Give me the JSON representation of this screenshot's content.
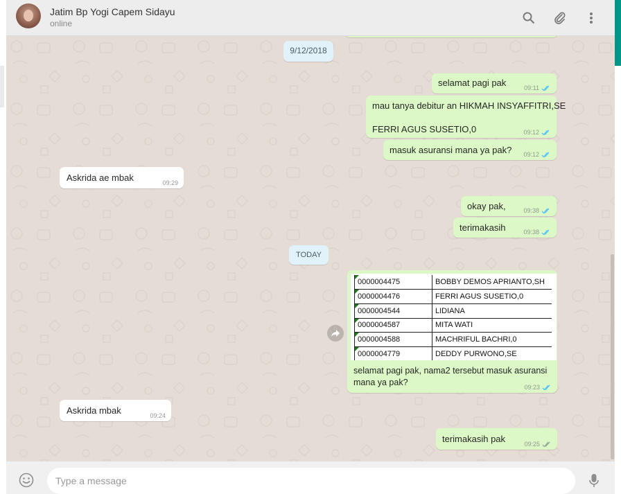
{
  "header": {
    "contact_name": "Jatim Bp Yogi Capem Sidayu",
    "status": "online",
    "icons": [
      "search-icon",
      "attach-icon",
      "menu-icon"
    ]
  },
  "dates": {
    "first": "9/12/2018",
    "today": "TODAY"
  },
  "messages": [
    {
      "dir": "out",
      "text": "selamat pagi pak",
      "time": "09:11"
    },
    {
      "dir": "out",
      "lines": [
        "mau tanya debitur an HIKMAH INSYAFFITRI,SE",
        "FERRI AGUS SUSETIO,0"
      ],
      "time": "09:12"
    },
    {
      "dir": "out",
      "text": "masuk asuransi mana ya pak?",
      "time": "09:12"
    },
    {
      "dir": "in",
      "text": "Askrida ae mbak",
      "time": "09:29"
    },
    {
      "dir": "out",
      "text": "okay pak,",
      "time": "09:38"
    },
    {
      "dir": "out",
      "text": "terimakasih",
      "time": "09:38"
    },
    {
      "dir": "out",
      "caption": [
        "selamat pagi pak, nama2 tersebut masuk asuransi",
        "mana ya pak?"
      ],
      "time": "09:23",
      "table": [
        [
          "0000004475",
          "BOBBY DEMOS APRIANTO,SH"
        ],
        [
          "0000004476",
          "FERRI AGUS SUSETIO,0"
        ],
        [
          "0000004544",
          "LIDIANA"
        ],
        [
          "0000004587",
          "MITA WATI"
        ],
        [
          "0000004588",
          "MACHRIFUL BACHRI,0"
        ],
        [
          "0000004779",
          "DEDDY PURWONO,SE"
        ]
      ]
    },
    {
      "dir": "in",
      "text": "Askrida mbak",
      "time": "09:24"
    },
    {
      "dir": "out",
      "text": "terimakasih pak",
      "time": "09:25"
    }
  ],
  "composer": {
    "placeholder": "Type a message"
  },
  "colors": {
    "outgoing_bubble": "#dcf8c6",
    "incoming_bubble": "#ffffff",
    "chat_background": "#e5ddd5",
    "read_ticks": "#4fc3f7",
    "accent": "#009688"
  }
}
